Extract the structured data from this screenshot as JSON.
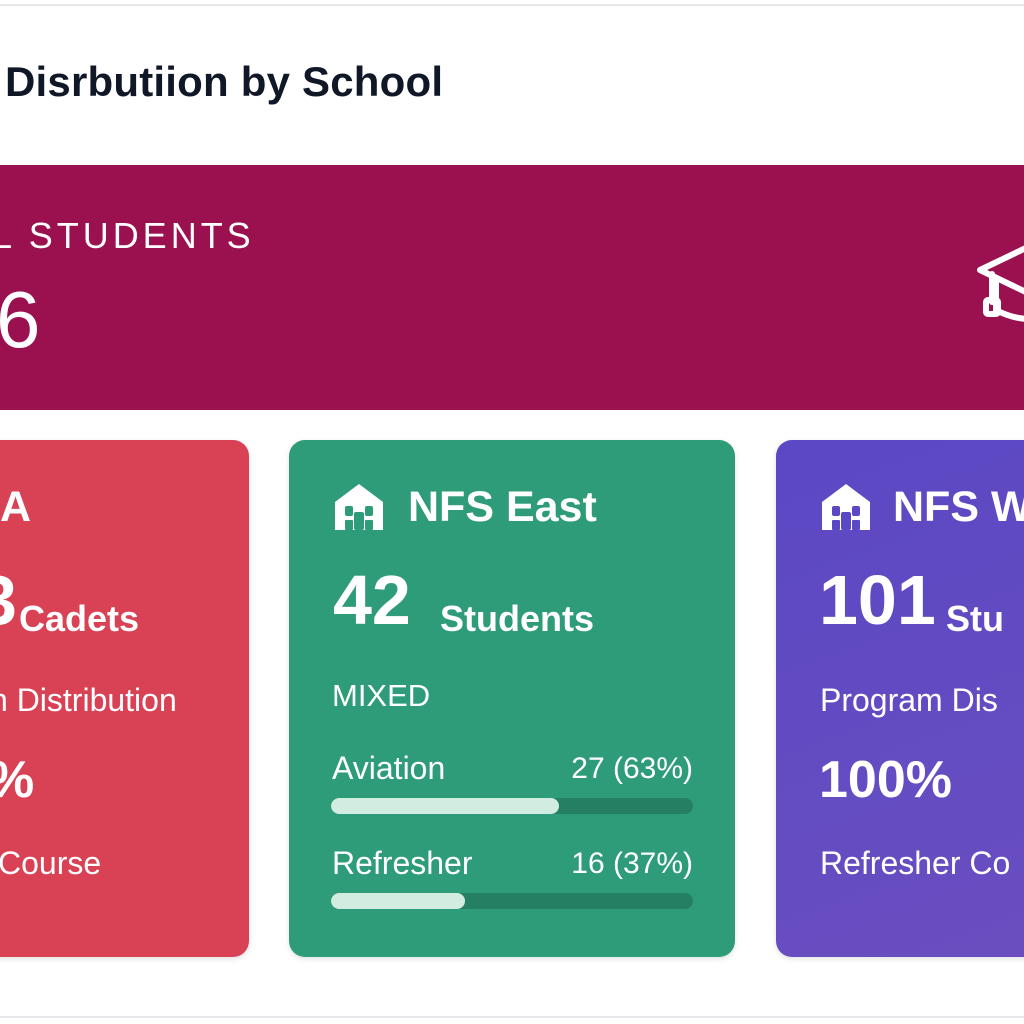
{
  "header": {
    "title": "Disrbutiion by School"
  },
  "total": {
    "label": "L STUDENTS",
    "value": "6",
    "icon": "graduation-cap-icon",
    "color": "#9b1150"
  },
  "schools": [
    {
      "name": "A",
      "count": "3",
      "unit": "Cadets",
      "program_heading": "n Distribution",
      "program_pct": "%",
      "program_course": "Course",
      "color": "#d94255"
    },
    {
      "name": "NFS East",
      "icon": "school-building-icon",
      "count": "42",
      "unit": "Students",
      "gender": "MIXED",
      "programs": [
        {
          "label": "Aviation",
          "value_text": "27 (63%)",
          "fraction": 0.63
        },
        {
          "label": "Refresher",
          "value_text": "16 (37%)",
          "fraction": 0.37
        }
      ],
      "color": "#2e9c78"
    },
    {
      "name": "NFS W",
      "icon": "school-building-icon",
      "count": "101",
      "unit": "Stu",
      "program_heading": "Program Dis",
      "program_pct": "100%",
      "program_course": "Refresher Co",
      "color": "#5b48c4"
    }
  ]
}
